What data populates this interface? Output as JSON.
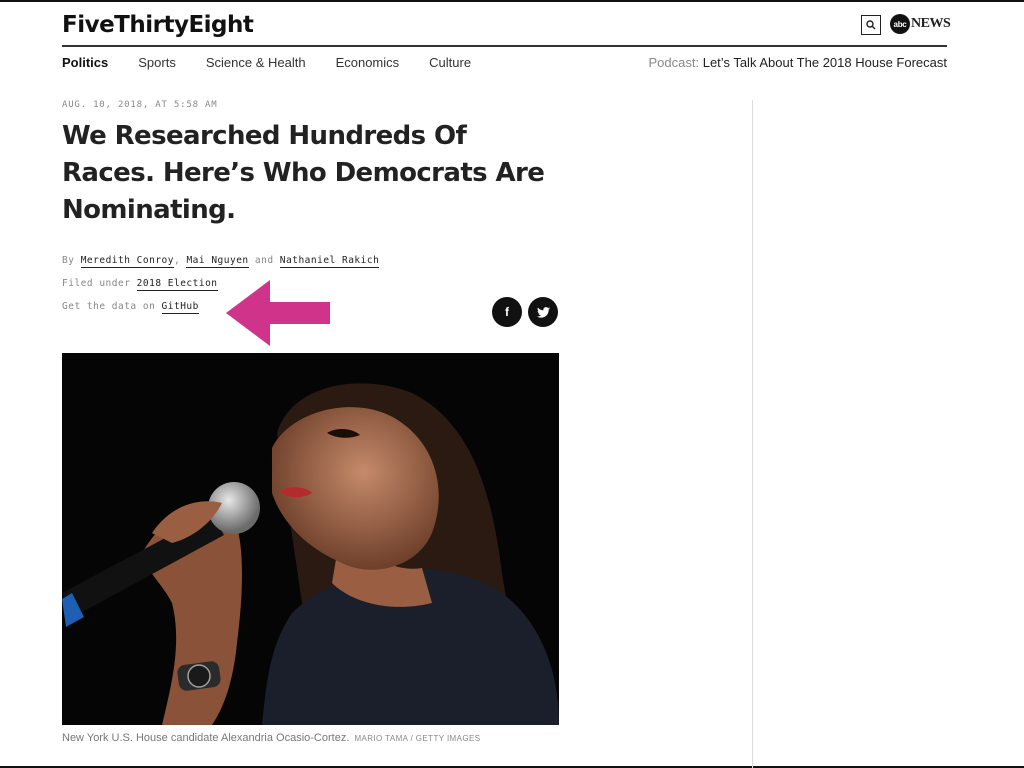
{
  "site": {
    "logo": "FiveThirtyEight",
    "partner": {
      "badge": "abc",
      "name": "NEWS"
    }
  },
  "nav": {
    "items": [
      {
        "label": "Politics",
        "active": true
      },
      {
        "label": "Sports",
        "active": false
      },
      {
        "label": "Science & Health",
        "active": false
      },
      {
        "label": "Economics",
        "active": false
      },
      {
        "label": "Culture",
        "active": false
      }
    ],
    "podcast_label": "Podcast:",
    "podcast_title": "Let’s Talk About The 2018 House Forecast"
  },
  "article": {
    "dateline": "AUG. 10, 2018, AT 5:58 AM",
    "headline": "We Researched Hundreds Of Races. Here’s Who Democrats Are Nominating.",
    "byline": {
      "prefix": "By",
      "authors": [
        "Meredith Conroy",
        "Mai Nguyen",
        "Nathaniel Rakich"
      ],
      "sep1": ",",
      "sep2": "and"
    },
    "filed": {
      "prefix": "Filed under",
      "tag": "2018 Election"
    },
    "data": {
      "prefix": "Get the data on",
      "link": "GitHub"
    },
    "photo_caption": "New York U.S. House candidate Alexandria Ocasio-Cortez.",
    "photo_credit": "MARIO TAMA / GETTY IMAGES"
  },
  "social": {
    "facebook": "f",
    "twitter": "twitter"
  },
  "colors": {
    "arrow": "#d0338a",
    "text": "#222222",
    "muted": "#888888"
  }
}
